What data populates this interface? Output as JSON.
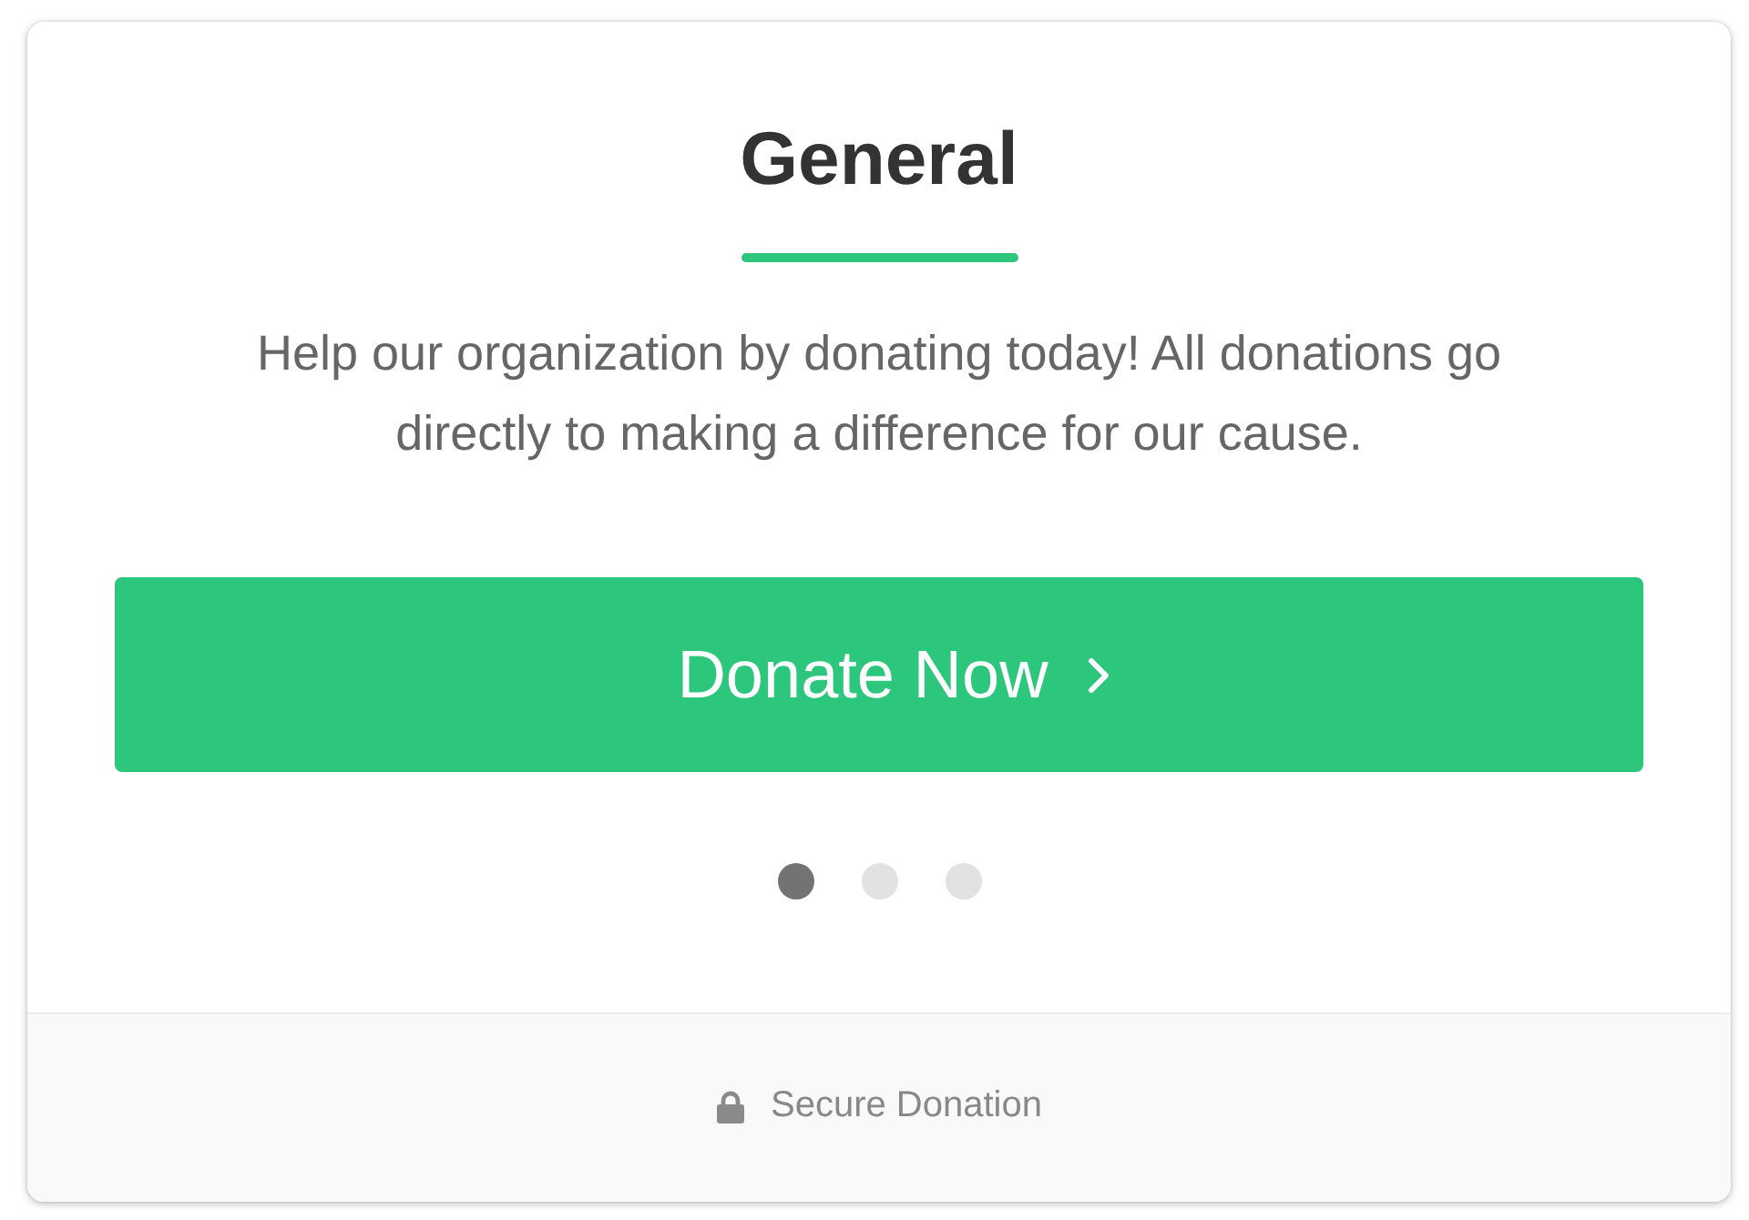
{
  "card": {
    "title": "General",
    "description": "Help our organization by donating today! All donations go directly to making a difference for our cause.",
    "donate_button": {
      "label": "Donate Now"
    },
    "pager_dots": [
      {
        "selected": true
      },
      {
        "selected": false
      },
      {
        "selected": false
      }
    ]
  },
  "footer": {
    "label": "Secure Donation"
  }
}
